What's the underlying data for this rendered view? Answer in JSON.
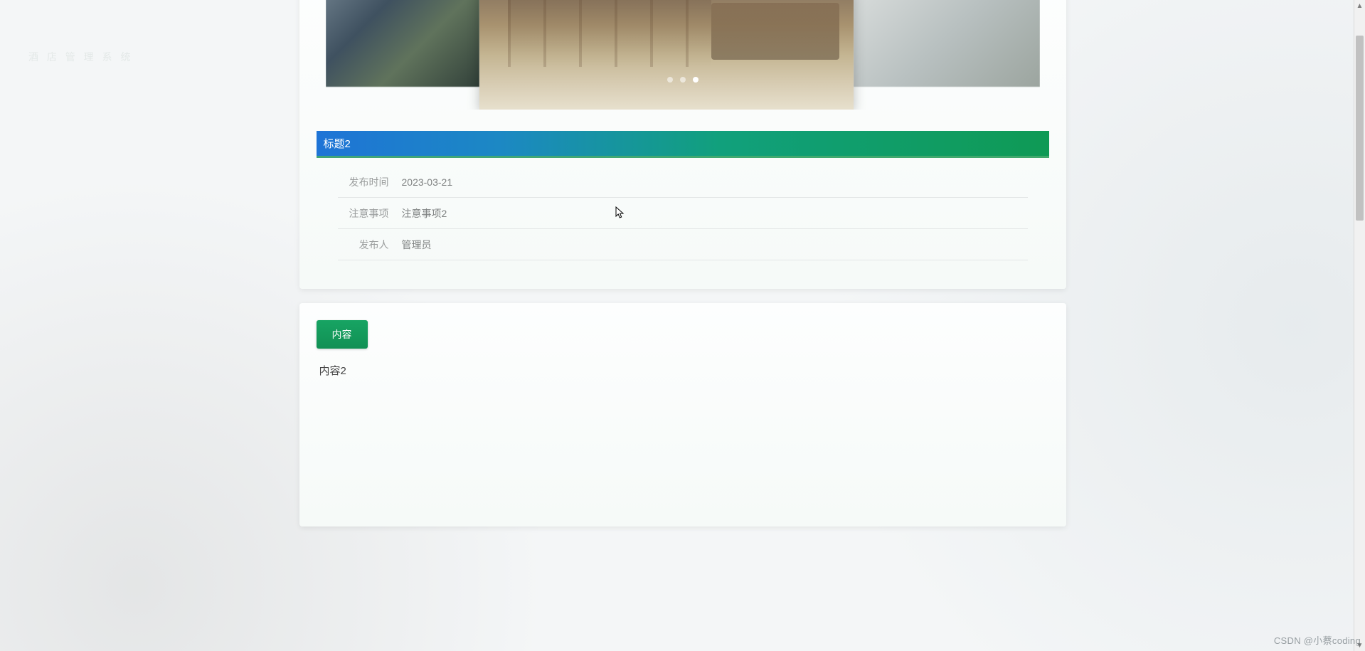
{
  "carousel": {
    "active_index": 2,
    "dot_count": 3
  },
  "title_bar": {
    "text": "标题2"
  },
  "info_rows": [
    {
      "label": "发布时间",
      "value": "2023-03-21"
    },
    {
      "label": "注意事项",
      "value": "注意事项2"
    },
    {
      "label": "发布人",
      "value": "管理员"
    }
  ],
  "content_card": {
    "tab_label": "内容",
    "body_text": "内容2"
  },
  "watermark": "CSDN @小蔡coding"
}
